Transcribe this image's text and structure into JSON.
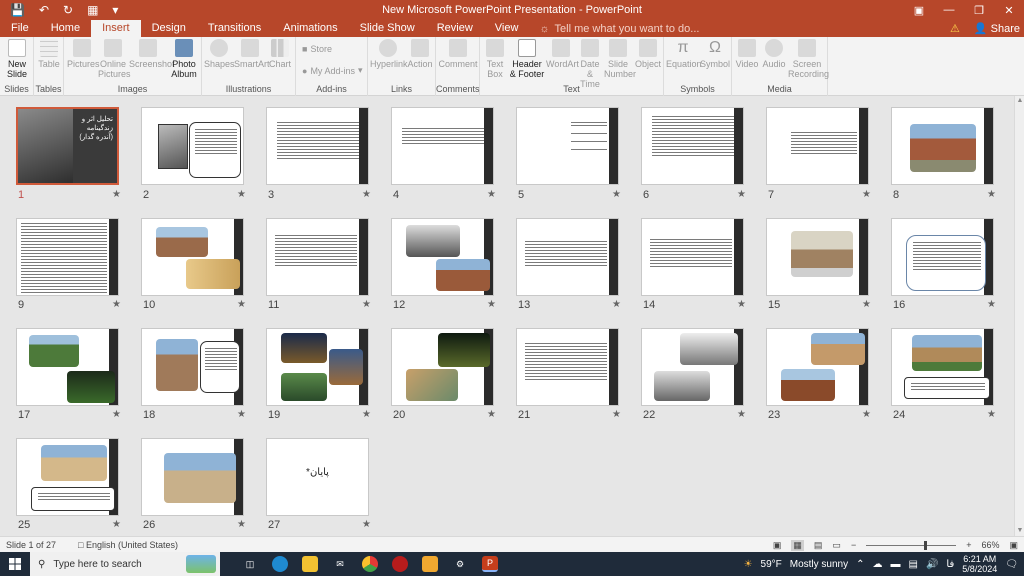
{
  "window": {
    "title": "New Microsoft PowerPoint Presentation  -  PowerPoint"
  },
  "tabs": [
    "File",
    "Home",
    "Insert",
    "Design",
    "Transitions",
    "Animations",
    "Slide Show",
    "Review",
    "View"
  ],
  "active_tab": "Insert",
  "tell_me": "Tell me what you want to do...",
  "share": "Share",
  "ribbon": {
    "new_slide": "New Slide",
    "new_slide_line2": "Slide",
    "new_slide_line1": "New",
    "table": "Table",
    "pictures": "Pictures",
    "online_pictures_1": "Online",
    "online_pictures_2": "Pictures",
    "screenshot": "Screenshot",
    "photo_album_1": "Photo",
    "photo_album_2": "Album",
    "shapes": "Shapes",
    "smartart": "SmartArt",
    "chart": "Chart",
    "store": "Store",
    "my_addins": "My Add-ins",
    "hyperlink": "Hyperlink",
    "action": "Action",
    "comment": "Comment",
    "text_box_1": "Text",
    "text_box_2": "Box",
    "header_footer_1": "Header",
    "header_footer_2": "& Footer",
    "wordart": "WordArt",
    "date_time_1": "Date &",
    "date_time_2": "Time",
    "slide_number_1": "Slide",
    "slide_number_2": "Number",
    "object": "Object",
    "equation": "Equation",
    "symbol": "Symbol",
    "video": "Video",
    "audio": "Audio",
    "screen_recording_1": "Screen",
    "screen_recording_2": "Recording",
    "groups": {
      "slides": "Slides",
      "tables": "Tables",
      "images": "Images",
      "illustrations": "Illustrations",
      "addins": "Add-ins",
      "links": "Links",
      "comments": "Comments",
      "text": "Text",
      "symbols": "Symbols",
      "media": "Media"
    }
  },
  "slides": [
    {
      "num": "1",
      "title_lines": [
        "تحلیل اثر و",
        "زندگینامه",
        "(آندره گدار)"
      ]
    },
    {
      "num": "2"
    },
    {
      "num": "3"
    },
    {
      "num": "4"
    },
    {
      "num": "5"
    },
    {
      "num": "6"
    },
    {
      "num": "7"
    },
    {
      "num": "8"
    },
    {
      "num": "9"
    },
    {
      "num": "10"
    },
    {
      "num": "11"
    },
    {
      "num": "12"
    },
    {
      "num": "13"
    },
    {
      "num": "14"
    },
    {
      "num": "15"
    },
    {
      "num": "16"
    },
    {
      "num": "17"
    },
    {
      "num": "18"
    },
    {
      "num": "19"
    },
    {
      "num": "20"
    },
    {
      "num": "21"
    },
    {
      "num": "22"
    },
    {
      "num": "23"
    },
    {
      "num": "24"
    },
    {
      "num": "25"
    },
    {
      "num": "26"
    },
    {
      "num": "27",
      "title": "*پایان"
    }
  ],
  "status": {
    "slide_of": "Slide 1 of 27",
    "language": "English (United States)",
    "zoom": "66%",
    "zoom_level": 0.66
  },
  "taskbar": {
    "search_placeholder": "Type here to search",
    "weather_temp": "59°F",
    "weather_desc": "Mostly sunny",
    "lang": "فا",
    "time": "6:21 AM",
    "date": "5/8/2024"
  },
  "colors": {
    "accent": "#b7472a",
    "selection": "#d05a3a",
    "taskbar": "#1f2b3a"
  }
}
